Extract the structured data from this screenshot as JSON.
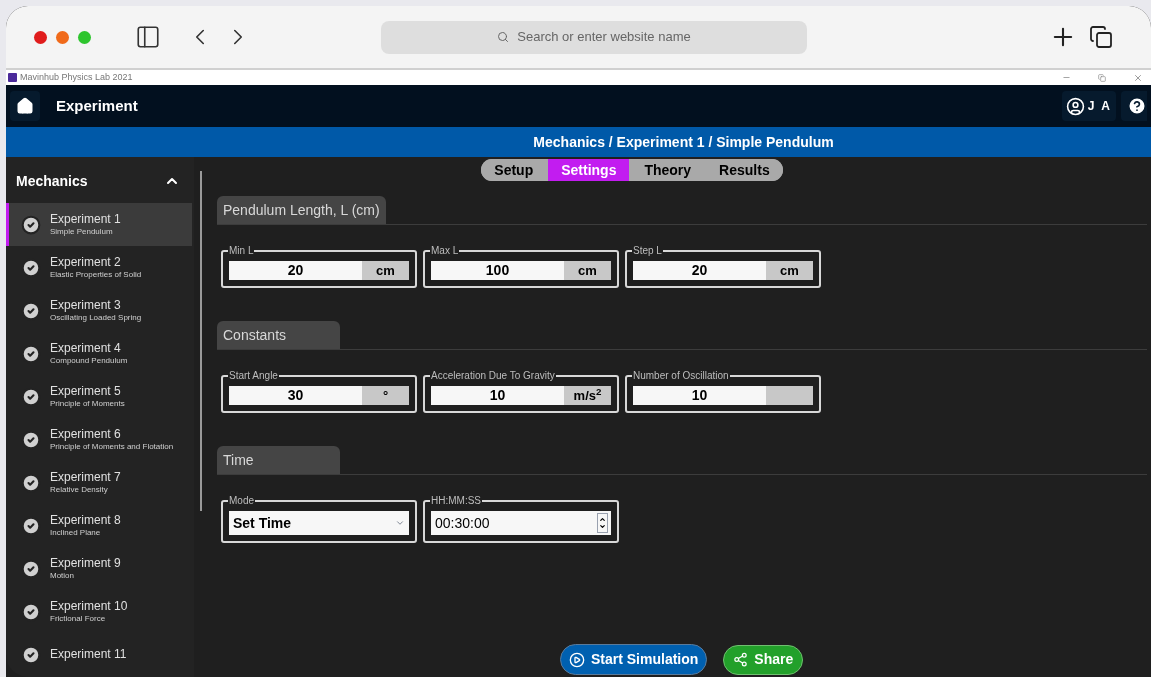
{
  "browser": {
    "address_placeholder": "Search or enter website name"
  },
  "window": {
    "title": "Mavinhub Physics Lab 2021"
  },
  "header": {
    "title": "Experiment",
    "user_initials": "J A"
  },
  "breadcrumb": "Mechanics / Experiment 1 / Simple Pendulum",
  "tabs": [
    {
      "label": "Setup",
      "selected": false
    },
    {
      "label": "Settings",
      "selected": true
    },
    {
      "label": "Theory",
      "selected": false
    },
    {
      "label": "Results",
      "selected": false
    }
  ],
  "sidebar": {
    "title": "Mechanics",
    "expanded": true,
    "items": [
      {
        "title": "Experiment 1",
        "subtitle": "Simple Pendulum",
        "selected": true,
        "done": true
      },
      {
        "title": "Experiment 2",
        "subtitle": "Elastic Properties of Solid",
        "selected": false,
        "done": true
      },
      {
        "title": "Experiment 3",
        "subtitle": "Oscillating Loaded Spring",
        "selected": false,
        "done": true
      },
      {
        "title": "Experiment 4",
        "subtitle": "Compound Pendulum",
        "selected": false,
        "done": true
      },
      {
        "title": "Experiment 5",
        "subtitle": "Principle of Moments",
        "selected": false,
        "done": true
      },
      {
        "title": "Experiment 6",
        "subtitle": "Principle of Moments and Flotation",
        "selected": false,
        "done": true
      },
      {
        "title": "Experiment 7",
        "subtitle": "Relative Density",
        "selected": false,
        "done": true
      },
      {
        "title": "Experiment 8",
        "subtitle": "Inclined Plane",
        "selected": false,
        "done": true
      },
      {
        "title": "Experiment 9",
        "subtitle": "Motion",
        "selected": false,
        "done": true
      },
      {
        "title": "Experiment 10",
        "subtitle": "Frictional Force",
        "selected": false,
        "done": true
      },
      {
        "title": "Experiment 11",
        "selected": false,
        "done": true
      }
    ]
  },
  "sections": [
    {
      "title": "Pendulum Length, L (cm)",
      "fields": [
        {
          "kind": "unit",
          "label": "Min L",
          "value": "20",
          "unit": "cm"
        },
        {
          "kind": "unit",
          "label": "Max L",
          "value": "100",
          "unit": "cm"
        },
        {
          "kind": "unit",
          "label": "Step L",
          "value": "20",
          "unit": "cm"
        }
      ]
    },
    {
      "title": "Constants",
      "fields": [
        {
          "kind": "unit",
          "label": "Start Angle",
          "value": "30",
          "unit": "°"
        },
        {
          "kind": "unit",
          "label": "Acceleration Due To Gravity",
          "value": "10",
          "unit": "m/s$^{2}$"
        },
        {
          "kind": "unit",
          "label": "Number of Oscillation",
          "value": "10"
        }
      ]
    },
    {
      "title": "Time",
      "fields": [
        {
          "kind": "select",
          "label": "Mode",
          "value": "Set Time"
        },
        {
          "kind": "spin",
          "label": "HH:MM:SS",
          "value": "00:30:00"
        }
      ]
    }
  ],
  "actions": [
    {
      "kind": "start",
      "label": "Start Simulation"
    },
    {
      "kind": "share",
      "label": "Share"
    }
  ]
}
